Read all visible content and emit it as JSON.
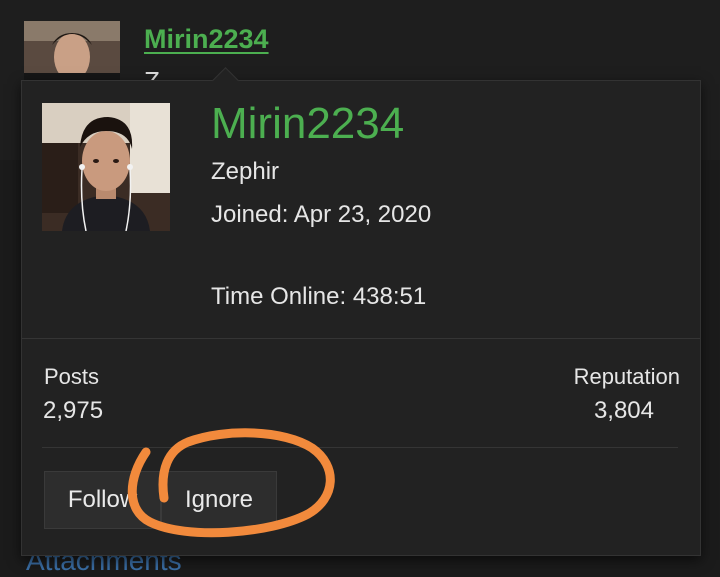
{
  "background": {
    "username": "Mirin2234",
    "attachments_label": "Attachments"
  },
  "popup": {
    "username": "Mirin2234",
    "user_title": "Zephir",
    "joined_text": "Joined: Apr 23, 2020",
    "time_online_text": "Time Online: 438:51",
    "stats": {
      "posts_label": "Posts",
      "posts_value": "2,975",
      "reputation_label": "Reputation",
      "reputation_value": "3,804"
    },
    "buttons": {
      "follow_label": "Follow",
      "ignore_label": "Ignore"
    }
  },
  "colors": {
    "username": "#4caf50",
    "popup_bg": "#222222",
    "annotation": "#f28a3c"
  },
  "icons": {
    "avatar": "user-avatar-photo"
  }
}
